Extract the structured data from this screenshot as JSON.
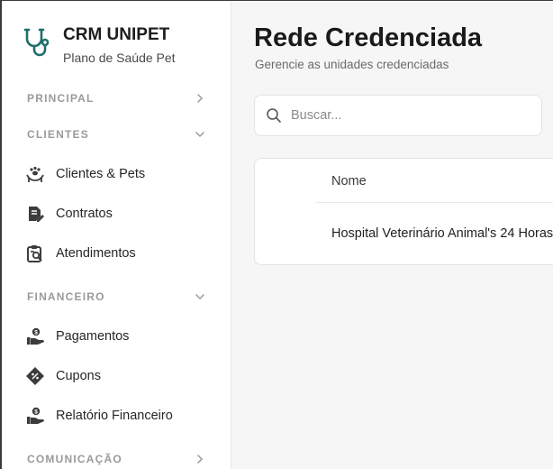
{
  "brand": {
    "title": "CRM UNIPET",
    "subtitle": "Plano de Saúde Pet",
    "icon": "stethoscope-icon",
    "accent": "#1f6f6a"
  },
  "sidebar": {
    "sections": [
      {
        "label": "PRINCIPAL",
        "state": "collapsed"
      },
      {
        "label": "CLIENTES",
        "state": "expanded",
        "items": [
          {
            "label": "Clientes & Pets",
            "icon": "pets-icon"
          },
          {
            "label": "Contratos",
            "icon": "contract-icon"
          },
          {
            "label": "Atendimentos",
            "icon": "clipboard-icon"
          }
        ]
      },
      {
        "label": "FINANCEIRO",
        "state": "expanded",
        "items": [
          {
            "label": "Pagamentos",
            "icon": "payment-icon"
          },
          {
            "label": "Cupons",
            "icon": "coupon-icon"
          },
          {
            "label": "Relatório Financeiro",
            "icon": "report-icon"
          }
        ]
      },
      {
        "label": "COMUNICAÇÃO",
        "state": "collapsed"
      }
    ]
  },
  "main": {
    "title": "Rede Credenciada",
    "subtitle": "Gerencie as unidades credenciadas",
    "search": {
      "placeholder": "Buscar..."
    },
    "table": {
      "columns": [
        "Nome"
      ],
      "rows": [
        [
          "Hospital Veterinário Animal's 24 Horas"
        ]
      ]
    }
  }
}
